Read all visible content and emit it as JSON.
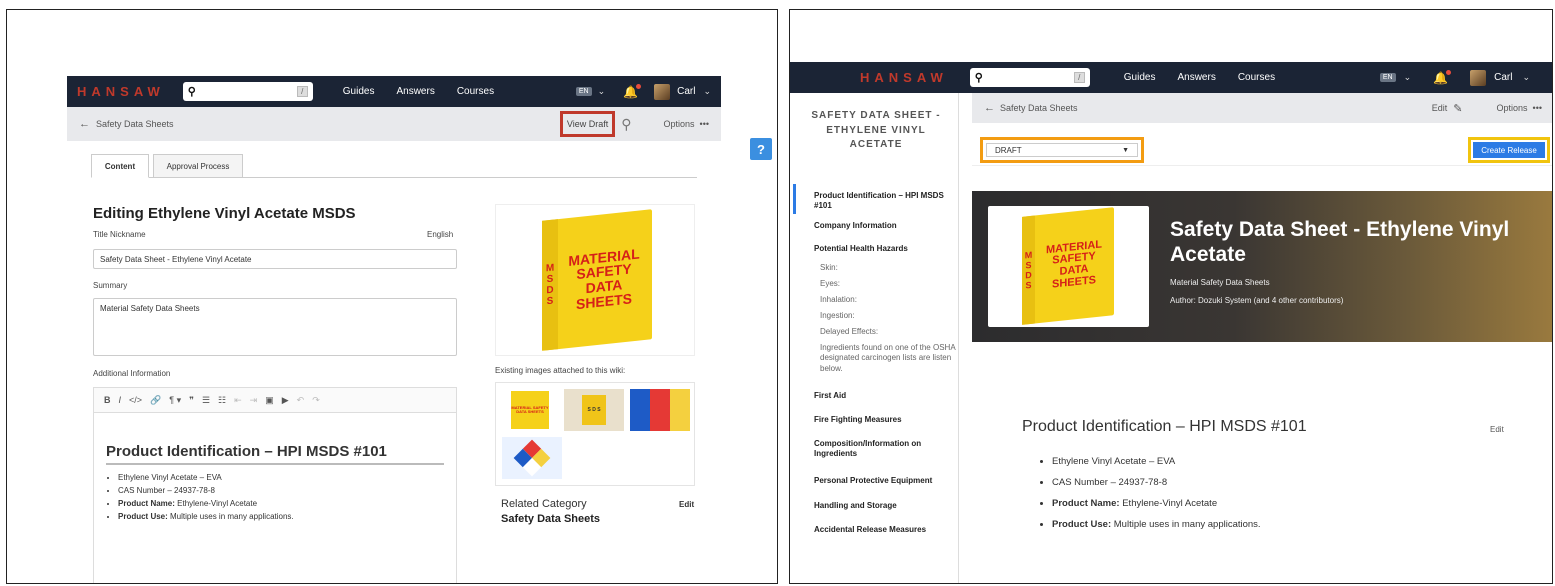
{
  "left": {
    "nav": {
      "logo": "HANSAW",
      "search_key": "/",
      "links": [
        "Guides",
        "Answers",
        "Courses"
      ],
      "lang": "EN",
      "user": "Carl"
    },
    "subbar": {
      "back_label": "Safety Data Sheets",
      "view_draft": "View Draft",
      "options": "Options",
      "options_dots": "•••"
    },
    "help": "?",
    "tabs": [
      "Content",
      "Approval Process"
    ],
    "editor": {
      "heading": "Editing Ethylene Vinyl Acetate MSDS",
      "title_label": "Title Nickname",
      "lang_label": "English",
      "title_value": "Safety Data Sheet - Ethylene Vinyl Acetate",
      "summary_label": "Summary",
      "summary_value": "Material Safety Data Sheets",
      "additional_label": "Additional Information",
      "toolbar": [
        "B",
        "I",
        "</>",
        "🔗",
        "¶ ▾",
        "❞",
        "☰",
        "☷",
        "⇤",
        "⇥",
        "▣",
        "▶",
        "↶",
        "↷"
      ],
      "content_heading": "Product Identification – HPI MSDS #101",
      "bullets": [
        {
          "bold": "",
          "text": "Ethylene Vinyl Acetate – EVA"
        },
        {
          "bold": "",
          "text": "CAS Number – 24937-78-8"
        },
        {
          "bold": "Product Name:",
          "text": " Ethylene-Vinyl Acetate"
        },
        {
          "bold": "Product Use:",
          "text": " Multiple uses in many applications."
        }
      ]
    },
    "binder": {
      "lines": [
        "MATERIAL",
        "SAFETY",
        "DATA",
        "SHEETS"
      ],
      "spine": [
        "M",
        "S",
        "D",
        "S"
      ]
    },
    "existing_label": "Existing images attached to this wiki:",
    "thumb_binder": "MATERIAL SAFETY DATA SHEETS",
    "thumb_sds": "S D S",
    "related_label": "Related Category",
    "related_edit": "Edit",
    "related_value": "Safety Data Sheets"
  },
  "right": {
    "nav": {
      "logo": "HANSAW",
      "search_key": "/",
      "links": [
        "Guides",
        "Answers",
        "Courses"
      ],
      "lang": "EN",
      "user": "Carl"
    },
    "sidebar_title": "SAFETY DATA SHEET - ETHYLENE VINYL ACETATE",
    "sidebar": [
      {
        "label": "Product Identification – HPI MSDS #101"
      },
      {
        "label": "Company Information"
      },
      {
        "label": "Potential Health Hazards"
      },
      {
        "sub": "Skin:"
      },
      {
        "sub": "Eyes:"
      },
      {
        "sub": "Inhalation:"
      },
      {
        "sub": "Ingestion:"
      },
      {
        "sub": "Delayed Effects:"
      },
      {
        "sub": "Ingredients found on one of the OSHA designated carcinogen lists are listen below."
      },
      {
        "label": "First Aid"
      },
      {
        "label": "Fire Fighting Measures"
      },
      {
        "label": "Composition/Information on Ingredients"
      },
      {
        "label": "Personal Protective Equipment"
      },
      {
        "label": "Handling and Storage"
      },
      {
        "label": "Accidental Release Measures"
      }
    ],
    "subbar": {
      "back_label": "Safety Data Sheets",
      "edit": "Edit",
      "options": "Options",
      "options_dots": "•••"
    },
    "status_select": "DRAFT",
    "create_release": "Create Release",
    "hero": {
      "title": "Safety Data Sheet - Ethylene Vinyl Acetate",
      "category": "Material Safety Data Sheets",
      "author": "Author: Dozuki System (and 4 other contributors)"
    },
    "binder": {
      "lines": [
        "MATERIAL",
        "SAFETY",
        "DATA",
        "SHEETS"
      ],
      "spine": [
        "M",
        "S",
        "D",
        "S"
      ]
    },
    "section_heading": "Product Identification – HPI MSDS #101",
    "section_edit": "Edit",
    "bullets": [
      {
        "bold": "",
        "text": "Ethylene Vinyl Acetate – EVA"
      },
      {
        "bold": "",
        "text": "CAS Number – 24937-78-8"
      },
      {
        "bold": "Product Name:",
        "text": " Ethylene-Vinyl Acetate"
      },
      {
        "bold": "Product Use:",
        "text": " Multiple uses in many applications."
      }
    ]
  },
  "colors": {
    "nav": "#1b2435",
    "logo": "#c0392b",
    "primary": "#2c7be5",
    "help": "#3b8fe0",
    "highlight_red": "#c0392b",
    "highlight_orange": "#f39c12",
    "highlight_yellow": "#f1c40f"
  }
}
